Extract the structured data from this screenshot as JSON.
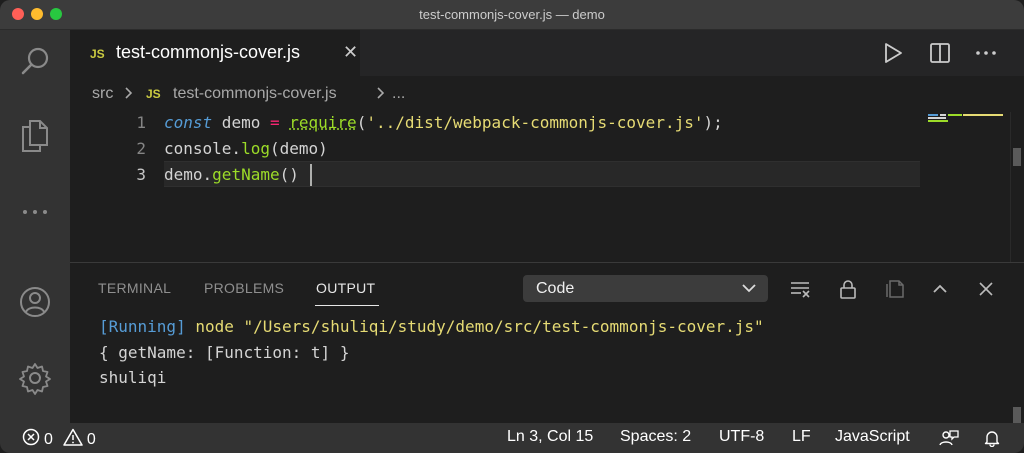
{
  "window": {
    "title": "test-commonjs-cover.js — demo"
  },
  "activity_bar": {
    "icons": [
      "search-icon",
      "explorer-icon",
      "more-icon",
      "account-icon",
      "settings-gear-icon"
    ]
  },
  "tab": {
    "badge": "JS",
    "label": "test-commonjs-cover.js",
    "close": "✕"
  },
  "breadcrumb": {
    "folder": "src",
    "badge": "JS",
    "file": "test-commonjs-cover.js",
    "more": "..."
  },
  "editor": {
    "line_numbers": [
      "1",
      "2",
      "3"
    ],
    "lines": [
      {
        "t1": "const",
        "t2": " demo ",
        "t3": "=",
        "t4": " ",
        "t5": "require",
        "t6": "(",
        "t7": "'../dist/webpack-commonjs-cover.js'",
        "t8": ");"
      },
      {
        "t1": "console.",
        "t2": "log",
        "t3": "(demo)"
      },
      {
        "t1": "demo.",
        "t2": "getName",
        "t3": "()"
      }
    ]
  },
  "panel": {
    "tabs": [
      "TERMINAL",
      "PROBLEMS",
      "OUTPUT"
    ],
    "active_tab": "OUTPUT",
    "channel": "Code",
    "output": {
      "running_tag": "[Running]",
      "command": " node \"/Users/shuliqi/study/demo/src/test-commonjs-cover.js\"",
      "line2": "{ getName: [Function: t] }",
      "line3": "shuliqi"
    }
  },
  "status_bar": {
    "errors": "0",
    "warnings": "0",
    "position": "Ln 3, Col 15",
    "spaces": "Spaces: 2",
    "encoding": "UTF-8",
    "eol": "LF",
    "language": "JavaScript"
  },
  "colors": {
    "keyword": "#569cd6",
    "function": "#9cdc28",
    "string": "#e6db74",
    "operator": "#f92672",
    "js_badge": "#cbcb41"
  }
}
